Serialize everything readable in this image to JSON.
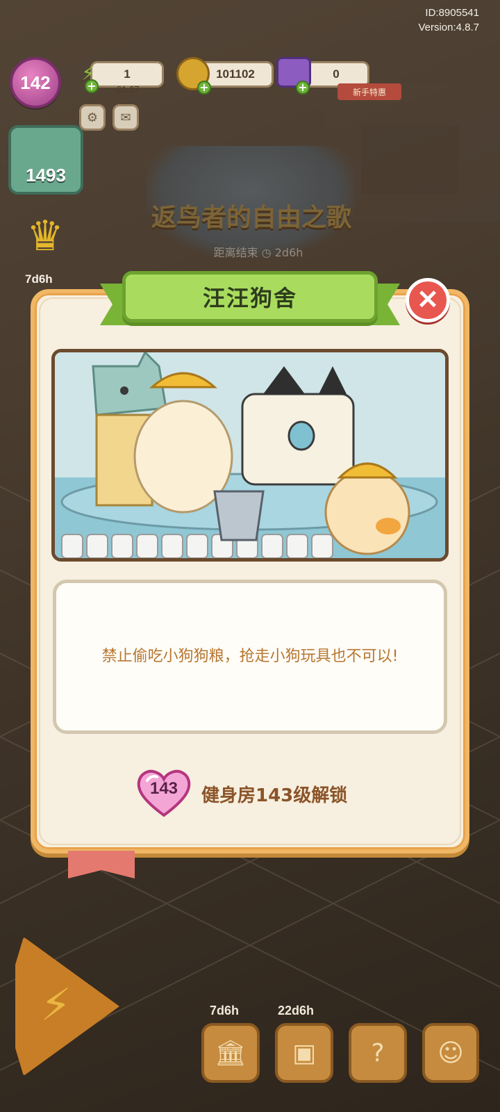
{
  "build_info": {
    "id": "ID:8905541",
    "version": "Version:4.8.7"
  },
  "hud": {
    "player_level": "142",
    "energy_value": "1",
    "energy_timer": "01:27",
    "coins_value": "101102",
    "gems_value": "0",
    "newbie_tag": "新手特惠"
  },
  "side": {
    "task_count": "1493",
    "crown_timer": "7d6h"
  },
  "event": {
    "title": "返鸟者的自由之歌",
    "countdown_label": "距离结束",
    "countdown_value": "2d6h"
  },
  "bottom_bar": {
    "timer_1": "7d6h",
    "timer_2": "22d6h"
  },
  "modal": {
    "title": "汪汪狗舍",
    "description": "禁止偷吃小狗狗粮，抢走小狗玩具也不可以!",
    "unlock_level": "143",
    "unlock_text": "健身房143级解锁",
    "close_icon": "close-x-icon"
  },
  "colors": {
    "ribbon_green": "#a9dc5e",
    "close_red": "#e8574f",
    "modal_bg": "#f7efdf",
    "modal_border": "#f0b765",
    "desc_text": "#b6762f",
    "unlock_text": "#8a5429",
    "heart_pink": "#f3a6d6"
  }
}
